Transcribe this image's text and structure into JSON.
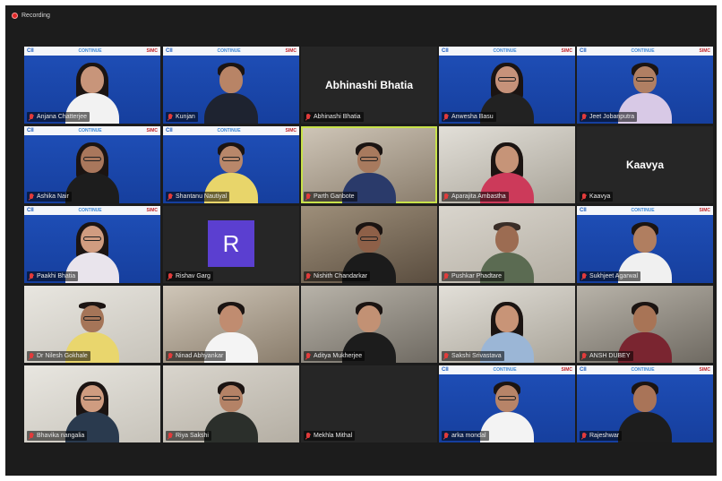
{
  "recording": {
    "label": "Recording"
  },
  "banner": {
    "left_logo": "CII",
    "center_logo": "CONTINUE",
    "right_logo": "SIMC"
  },
  "tiles": [
    {
      "name": "Anjana Chatterjee",
      "center_text": "",
      "avatar_letter": ""
    },
    {
      "name": "Kunjan",
      "center_text": "",
      "avatar_letter": ""
    },
    {
      "name": "Abhinashi Bhatia",
      "center_text": "Abhinashi Bhatia",
      "avatar_letter": ""
    },
    {
      "name": "Anwesha Basu",
      "center_text": "",
      "avatar_letter": ""
    },
    {
      "name": "Jeet Jobanputra",
      "center_text": "",
      "avatar_letter": ""
    },
    {
      "name": "Ashika Nair",
      "center_text": "",
      "avatar_letter": ""
    },
    {
      "name": "Shantanu Nautiyal",
      "center_text": "",
      "avatar_letter": ""
    },
    {
      "name": "Parth Ganbote",
      "center_text": "",
      "avatar_letter": ""
    },
    {
      "name": "Aparajita Ambastha",
      "center_text": "",
      "avatar_letter": ""
    },
    {
      "name": "Kaavya",
      "center_text": "Kaavya",
      "avatar_letter": ""
    },
    {
      "name": "Paakhi Bhatia",
      "center_text": "",
      "avatar_letter": ""
    },
    {
      "name": "Rishav Garg",
      "center_text": "",
      "avatar_letter": "R"
    },
    {
      "name": "Nishith Chandarkar",
      "center_text": "",
      "avatar_letter": ""
    },
    {
      "name": "Pushkar Phadtare",
      "center_text": "",
      "avatar_letter": ""
    },
    {
      "name": "Sukhjeet Agarwal",
      "center_text": "",
      "avatar_letter": ""
    },
    {
      "name": "Dr Nilesh Gokhale",
      "center_text": "",
      "avatar_letter": ""
    },
    {
      "name": "Ninad Abhyankar",
      "center_text": "",
      "avatar_letter": ""
    },
    {
      "name": "Aditya Mukherjee",
      "center_text": "",
      "avatar_letter": ""
    },
    {
      "name": "Sakshi Srivastava",
      "center_text": "",
      "avatar_letter": ""
    },
    {
      "name": "ANSH DUBEY",
      "center_text": "",
      "avatar_letter": ""
    },
    {
      "name": "Bhavika nangalia",
      "center_text": "",
      "avatar_letter": ""
    },
    {
      "name": "Riya Sakshi",
      "center_text": "",
      "avatar_letter": ""
    },
    {
      "name": "Mekhla Mithal",
      "center_text": "",
      "avatar_letter": ""
    },
    {
      "name": "arka mondal",
      "center_text": "",
      "avatar_letter": ""
    },
    {
      "name": "Rajeshwar",
      "center_text": "",
      "avatar_letter": ""
    }
  ]
}
